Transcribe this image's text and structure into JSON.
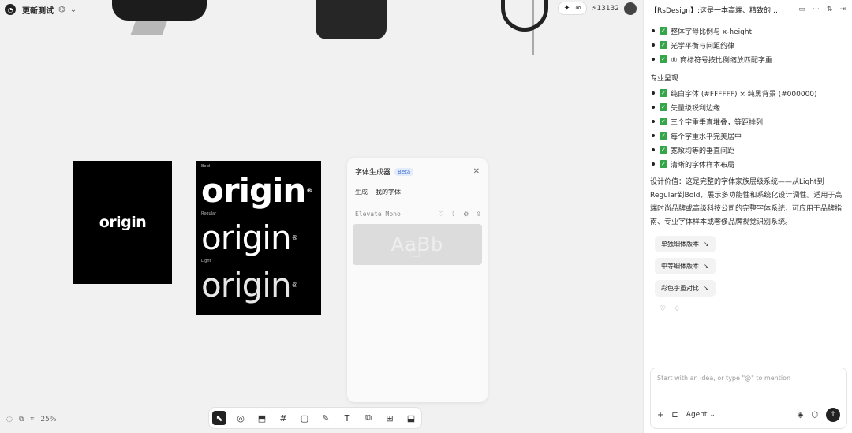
{
  "topbar": {
    "logo": "◔",
    "project_name": "更新测试",
    "project_icon": "⌬",
    "project_caret": "⌄",
    "tools": [
      "✦",
      "∞"
    ],
    "credits": "⚡13132"
  },
  "canvas": {
    "card_a_word": "origin",
    "card_b": {
      "rows": [
        {
          "label": "Bold",
          "word": "origin",
          "mark": "®"
        },
        {
          "label": "Regular",
          "word": "origin",
          "mark": "®"
        },
        {
          "label": "Light",
          "word": "origin",
          "mark": "®"
        }
      ]
    },
    "font_panel": {
      "title": "字体生成器",
      "beta": "Beta",
      "close": "✕",
      "tabs": [
        "生成",
        "我的字体"
      ],
      "font_name": "Elevate Mono",
      "actions": [
        "♡",
        "⇩",
        "⚙",
        "⇪"
      ],
      "preview": "AaBb",
      "cursor": "☝"
    },
    "zoom": "25%",
    "bottom_left_icons": [
      "◌",
      "⧉",
      "⌗"
    ],
    "tools": [
      "⬉",
      "◎",
      "⬒",
      "#",
      "▢",
      "✎",
      "T",
      "⧉",
      "⊞",
      "⬓"
    ]
  },
  "panel": {
    "title": "【RsDesign】:这是一本高端、精致的…",
    "header_icons": [
      "▭",
      "⋯",
      "⇅",
      "⇥"
    ],
    "bullets_a": [
      "整体字母比例与 x-height",
      "光学平衡与间距韵律",
      "® 商标符号按比例缩放匹配字重"
    ],
    "section_title": "专业呈现",
    "bullets_b": [
      "纯白字体 (#FFFFFF) × 纯黑背景 (#000000)",
      "矢量级锐利边缘",
      "三个字重垂直堆叠，等距排列",
      "每个字重水平完美居中",
      "宽敞均等的垂直间距",
      "清晰的字体样本布局"
    ],
    "paragraph": "设计价值：这是完整的字体家族层级系统——从Light到Regular到Bold，展示多功能性和系统化设计调性。适用于高端时尚品牌或高级科技公司的完整字体系统，可应用于品牌指南、专业字体样本或奢侈品牌视觉识别系统。",
    "chips": [
      "单独细体版本",
      "中等细体版本",
      "彩色字重对比"
    ],
    "chip_arrow": "↘",
    "feedback": [
      "♡",
      "♢"
    ],
    "input_placeholder": "Start with an idea, or type \"@\" to mention",
    "input_tools": [
      "+",
      "⊏"
    ],
    "agent_label": "Agent",
    "agent_caret": "⌄",
    "input_right_icons": [
      "◈",
      "⬡"
    ],
    "send": "↑"
  }
}
